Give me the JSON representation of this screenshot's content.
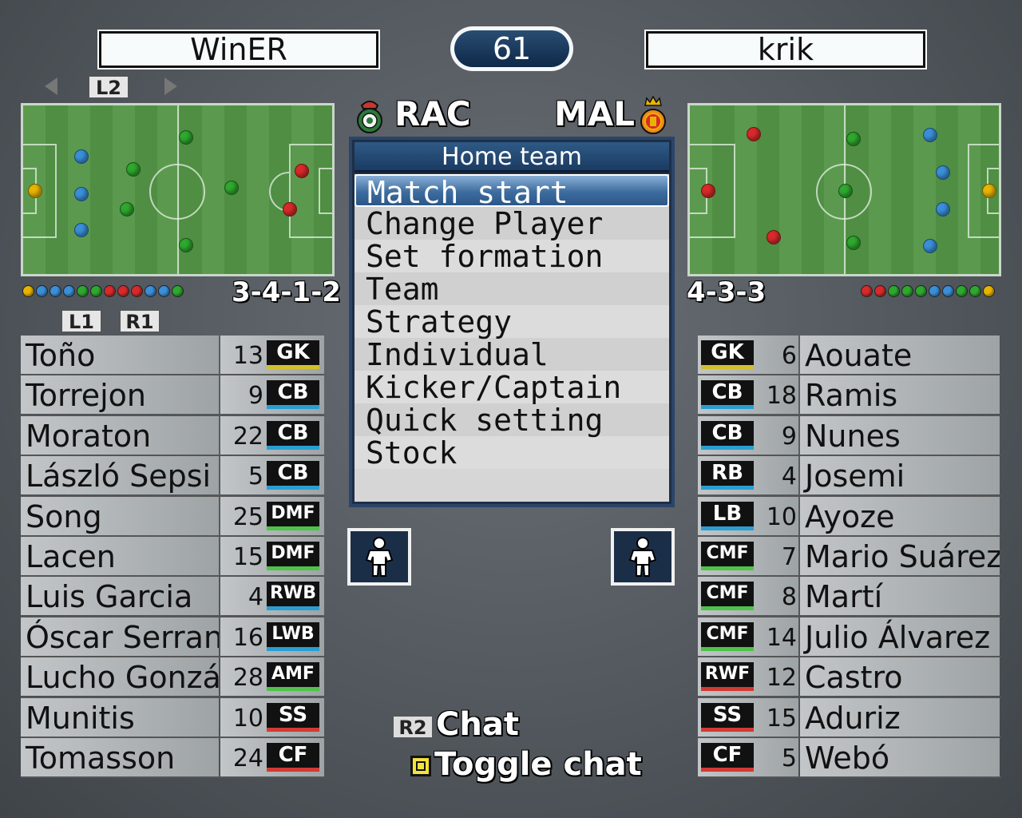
{
  "players": {
    "home_user": "WinER",
    "away_user": "krik"
  },
  "timer": "61",
  "buttons": {
    "l2": "L2",
    "l1": "L1",
    "r1": "R1",
    "r2": "R2"
  },
  "teams": {
    "home_abbr": "RAC",
    "away_abbr": "MAL"
  },
  "formations": {
    "home": "3-4-1-2",
    "away": "4-3-3"
  },
  "menu": {
    "header": "Home team",
    "items": [
      "Match start",
      "Change Player",
      "Set formation",
      "Team",
      "Strategy",
      "Individual",
      "Kicker/Captain",
      "Quick setting",
      "Stock"
    ]
  },
  "home_roster": [
    {
      "name": "Toño",
      "number": "13",
      "pos": "GK"
    },
    {
      "name": "Torrejon",
      "number": "9",
      "pos": "CB"
    },
    {
      "name": "Moraton",
      "number": "22",
      "pos": "CB"
    },
    {
      "name": "László Sepsi",
      "number": "5",
      "pos": "CB"
    },
    {
      "name": "Song",
      "number": "25",
      "pos": "DMF"
    },
    {
      "name": "Lacen",
      "number": "15",
      "pos": "DMF"
    },
    {
      "name": "Luis Garcia",
      "number": "4",
      "pos": "RWB"
    },
    {
      "name": "Óscar Serrano",
      "number": "16",
      "pos": "LWB"
    },
    {
      "name": "Lucho González",
      "number": "28",
      "pos": "AMF"
    },
    {
      "name": "Munitis",
      "number": "10",
      "pos": "SS"
    },
    {
      "name": "Tomasson",
      "number": "24",
      "pos": "CF"
    }
  ],
  "away_roster": [
    {
      "name": "Aouate",
      "number": "6",
      "pos": "GK"
    },
    {
      "name": "Ramis",
      "number": "18",
      "pos": "CB"
    },
    {
      "name": "Nunes",
      "number": "9",
      "pos": "CB"
    },
    {
      "name": "Josemi",
      "number": "4",
      "pos": "RB"
    },
    {
      "name": "Ayoze",
      "number": "10",
      "pos": "LB"
    },
    {
      "name": "Mario Suárez",
      "number": "7",
      "pos": "CMF"
    },
    {
      "name": "Martí",
      "number": "8",
      "pos": "CMF"
    },
    {
      "name": "Julio Álvarez",
      "number": "14",
      "pos": "CMF"
    },
    {
      "name": "Castro",
      "number": "12",
      "pos": "RWF"
    },
    {
      "name": "Aduriz",
      "number": "15",
      "pos": "SS"
    },
    {
      "name": "Webó",
      "number": "5",
      "pos": "CF"
    }
  ],
  "chat": {
    "chat_label": "Chat",
    "toggle_label": "Toggle chat"
  },
  "colors": {
    "gk": "#e8b400",
    "defender": "#3a8fd8",
    "midfielder": "#2ea82e",
    "forward": "#d82a2a",
    "menu_highlight": "#3d6c9e"
  }
}
